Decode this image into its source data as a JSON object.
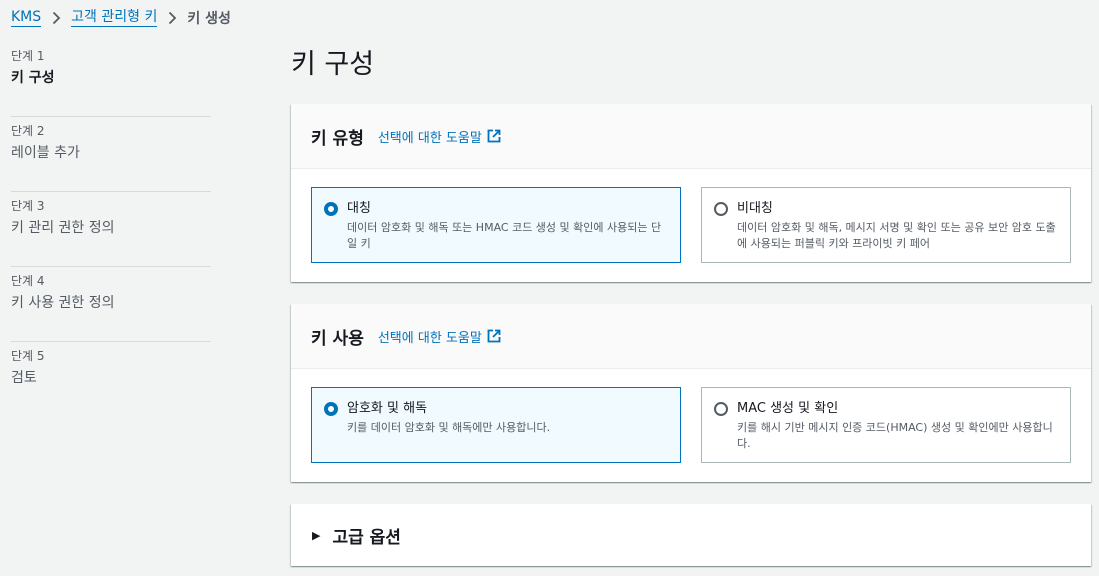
{
  "breadcrumb": {
    "items": [
      "KMS",
      "고객 관리형 키"
    ],
    "current": "키 생성"
  },
  "steps": [
    {
      "num": "단계 1",
      "name": "키 구성"
    },
    {
      "num": "단계 2",
      "name": "레이블 추가"
    },
    {
      "num": "단계 3",
      "name": "키 관리 권한 정의"
    },
    {
      "num": "단계 4",
      "name": "키 사용 권한 정의"
    },
    {
      "num": "단계 5",
      "name": "검토"
    }
  ],
  "page_title": "키 구성",
  "key_type": {
    "title": "키 유형",
    "info": "선택에 대한 도움말",
    "options": [
      {
        "title": "대칭",
        "desc": "데이터 암호화 및 해독 또는 HMAC 코드 생성 및 확인에 사용되는 단일 키",
        "selected": true
      },
      {
        "title": "비대칭",
        "desc": "데이터 암호화 및 해독, 메시지 서명 및 확인 또는 공유 보안 암호 도출에 사용되는 퍼블릭 키와 프라이빗 키 페어",
        "selected": false
      }
    ]
  },
  "key_usage": {
    "title": "키 사용",
    "info": "선택에 대한 도움말",
    "options": [
      {
        "title": "암호화 및 해독",
        "desc": "키를 데이터 암호화 및 해독에만 사용합니다.",
        "selected": true
      },
      {
        "title": "MAC 생성 및 확인",
        "desc": "키를 해시 기반 메시지 인증 코드(HMAC) 생성 및 확인에만 사용합니다.",
        "selected": false
      }
    ]
  },
  "advanced": {
    "label": "고급 옵션"
  },
  "colors": {
    "link": "#0073bb",
    "selected_bg": "#f1faff",
    "bg": "#f2f3f3"
  }
}
